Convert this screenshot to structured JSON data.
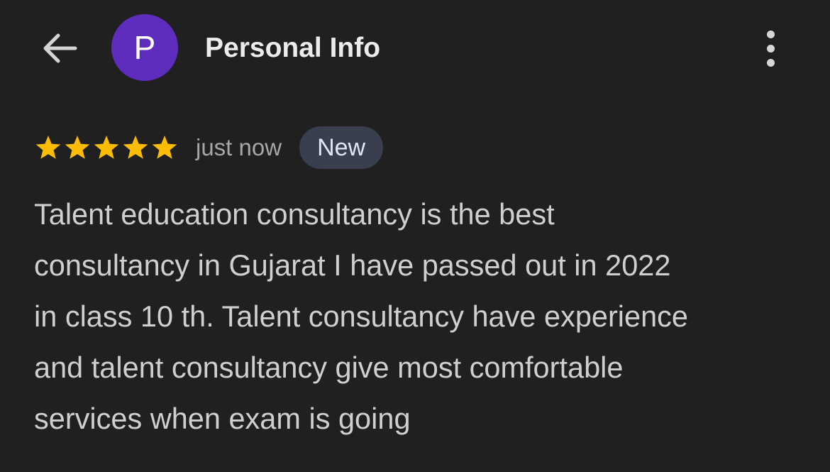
{
  "header": {
    "back_icon": "arrow-left-icon",
    "avatar_letter": "P",
    "avatar_color": "#5f2dbd",
    "title": "Personal Info",
    "more_icon": "more-vertical-icon"
  },
  "review": {
    "rating": 5,
    "rating_max": 5,
    "star_color": "#fbbc04",
    "timestamp": "just now",
    "badge_label": "New",
    "badge_color": "#3a3f50",
    "text": "Talent education consultancy is the best\nconsultancy in Gujarat I have passed out in 2022\nin class 10 th. Talent consultancy have experience\nand talent consultancy give most comfortable\nservices when exam is going"
  },
  "colors": {
    "background": "#202020",
    "title_text": "#ececec",
    "body_text": "#cfcfcf",
    "muted_text": "#a7a7a7"
  }
}
